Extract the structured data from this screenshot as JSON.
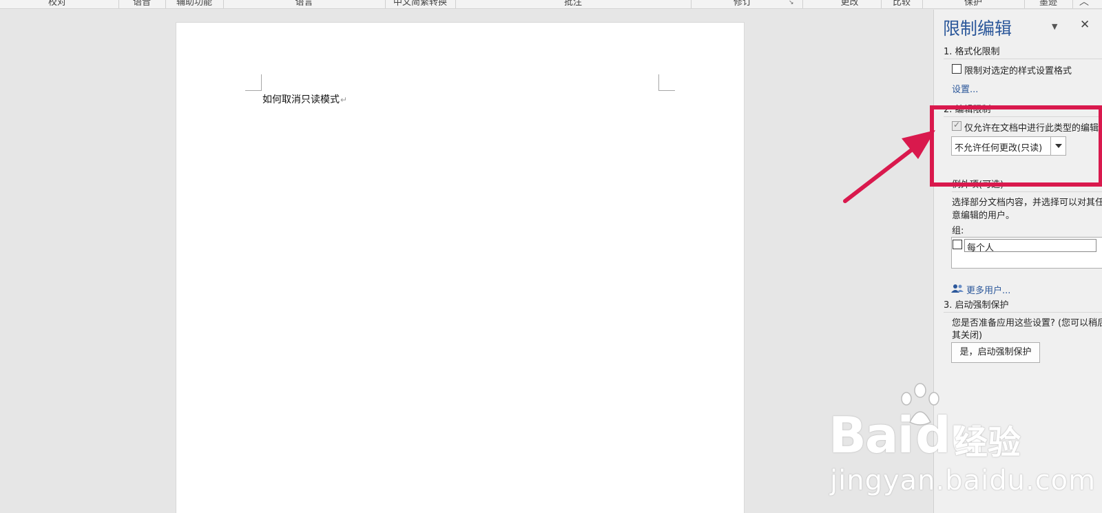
{
  "ribbon": {
    "groups": [
      "校对",
      "语音",
      "辅助功能",
      "语言",
      "中文简繁转换",
      "批注",
      "修订",
      "更改",
      "比较",
      "保护",
      "墨迹"
    ]
  },
  "document": {
    "text": "如何取消只读模式",
    "paragraph_mark": "↵"
  },
  "pane": {
    "title": "限制编辑",
    "section1": {
      "header": "1. 格式化限制",
      "checkbox_label": "限制对选定的样式设置格式",
      "checkbox_checked": false,
      "settings_link": "设置..."
    },
    "section2": {
      "header": "2. 编辑限制",
      "checkbox_label": "仅允许在文档中进行此类型的编辑",
      "checkbox_checked": true,
      "select_value": "不允许任何更改(只读)"
    },
    "exceptions": {
      "header": "例外项(可选)",
      "description_line1": "选择部分文档内容，并选择可以对其任",
      "description_line2": "意编辑的用户。",
      "groups_label": "组:",
      "everyone_label": "每个人",
      "everyone_checked": false,
      "more_users_link": "更多用户..."
    },
    "section3": {
      "header": "3. 启动强制保护",
      "description_line1": "您是否准备应用这些设置? (您可以稍后将",
      "description_line2": "其关闭)",
      "button_label": "是，启动强制保护"
    }
  },
  "watermark": {
    "brand": "Bai",
    "brand_du": "du",
    "jingyan": "经验",
    "url": "jingyan.baidu.com"
  },
  "colors": {
    "accent": "#2b579a",
    "annotation": "#d9194d"
  }
}
